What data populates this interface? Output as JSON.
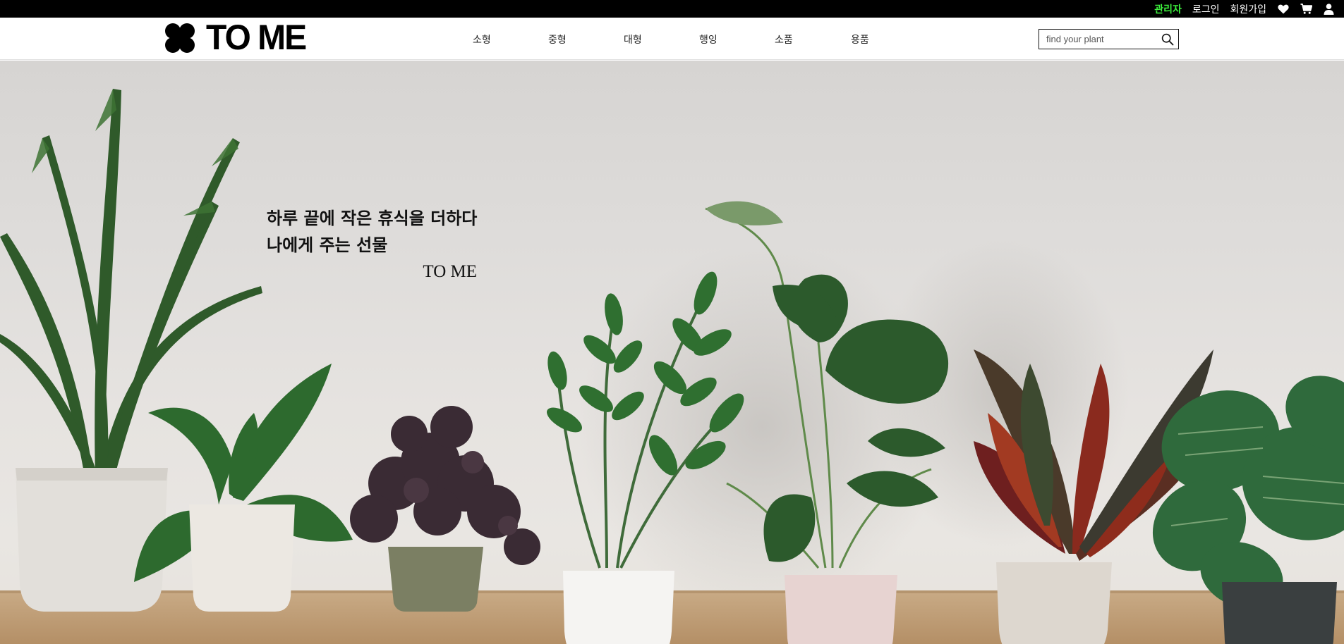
{
  "topbar": {
    "admin_label": "관리자",
    "login_label": "로그인",
    "signup_label": "회원가입",
    "icons": [
      "heart-icon",
      "cart-icon",
      "user-icon"
    ],
    "admin_color": "#3cf03c"
  },
  "header": {
    "logo_text": "TO ME",
    "logo_icon": "clover-icon",
    "nav": [
      {
        "label": "소형"
      },
      {
        "label": "중형"
      },
      {
        "label": "대형"
      },
      {
        "label": "행잉"
      },
      {
        "label": "소품"
      },
      {
        "label": "용품"
      }
    ],
    "search": {
      "placeholder": "find your plant",
      "value": "",
      "icon": "search-icon"
    }
  },
  "hero": {
    "line1": "하루 끝에 작은 휴식을 더하다",
    "line2": "나에게 주는 선물",
    "brand": "TO ME"
  },
  "colors": {
    "topbar_bg": "#000000",
    "header_bg": "#ffffff",
    "text": "#111111"
  }
}
